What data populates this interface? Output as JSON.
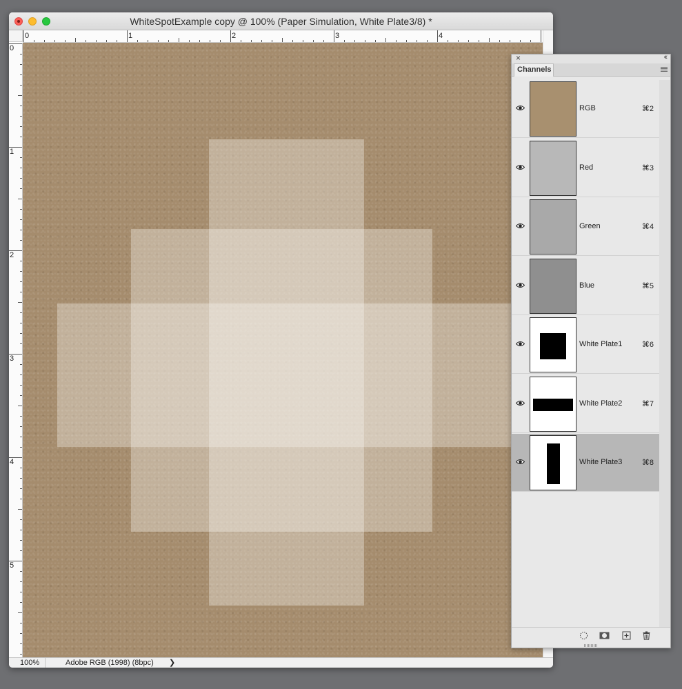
{
  "window": {
    "title": "WhiteSpotExample copy @ 100% (Paper Simulation, White Plate3/8) *"
  },
  "rulers": {
    "horizontal": [
      "0",
      "1",
      "2",
      "3",
      "4"
    ],
    "vertical": [
      "0",
      "1",
      "2",
      "3",
      "4",
      "5"
    ]
  },
  "status_bar": {
    "zoom": "100%",
    "profile": "Adobe RGB (1998) (8bpc)",
    "arrow": "❯"
  },
  "panel": {
    "tab": "Channels",
    "channels": [
      {
        "name": "RGB",
        "shortcut": "⌘2",
        "thumb": "rgb"
      },
      {
        "name": "Red",
        "shortcut": "⌘3",
        "thumb": "red"
      },
      {
        "name": "Green",
        "shortcut": "⌘4",
        "thumb": "green"
      },
      {
        "name": "Blue",
        "shortcut": "⌘5",
        "thumb": "blue"
      },
      {
        "name": "White Plate1",
        "shortcut": "⌘6",
        "thumb": "plate1"
      },
      {
        "name": "White Plate2",
        "shortcut": "⌘7",
        "thumb": "plate2"
      },
      {
        "name": "White Plate3",
        "shortcut": "⌘8",
        "thumb": "plate3",
        "selected": true
      }
    ],
    "bottom_icons": [
      "load-selection-icon",
      "save-selection-icon",
      "new-channel-icon",
      "trash-icon"
    ]
  },
  "colors": {
    "paper": "#a58c6d",
    "panel_selection": "#b7b7b7"
  }
}
